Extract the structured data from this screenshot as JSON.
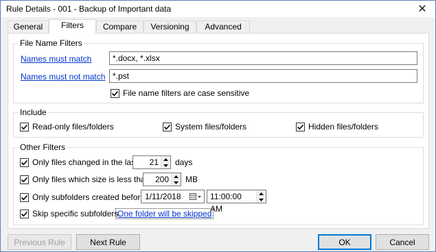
{
  "window": {
    "title": "Rule Details - 001 - Backup of Important data"
  },
  "tabs": [
    {
      "label": "General"
    },
    {
      "label": "Filters"
    },
    {
      "label": "Compare"
    },
    {
      "label": "Versioning"
    },
    {
      "label": "Advanced"
    }
  ],
  "active_tab": "Filters",
  "file_name_filters": {
    "title": "File Name Filters",
    "must_match_link": "Names must match",
    "must_match_value": "*.docx, *.xlsx",
    "must_not_match_link": "Names must not match",
    "must_not_match_value": "*.pst",
    "case_sensitive_label": "File name filters are case sensitive",
    "case_sensitive_checked": true
  },
  "include": {
    "title": "Include",
    "readonly_label": "Read-only files/folders",
    "readonly_checked": true,
    "system_label": "System files/folders",
    "system_checked": true,
    "hidden_label": "Hidden files/folders",
    "hidden_checked": true
  },
  "other_filters": {
    "title": "Other Filters",
    "changed_label": "Only files changed in the last",
    "changed_checked": true,
    "changed_value": "21",
    "changed_unit": "days",
    "size_label": "Only files which size is less than",
    "size_checked": true,
    "size_value": "200",
    "size_unit": "MB",
    "subfolders_label": "Only subfolders created before",
    "subfolders_checked": true,
    "date_value": "1/11/2018",
    "time_value": "11:00:00 AM",
    "skip_label": "Skip specific subfolders",
    "skip_checked": true,
    "skip_link": "One folder will be skipped"
  },
  "buttons": {
    "previous": "Previous Rule",
    "next": "Next Rule",
    "ok": "OK",
    "cancel": "Cancel"
  }
}
